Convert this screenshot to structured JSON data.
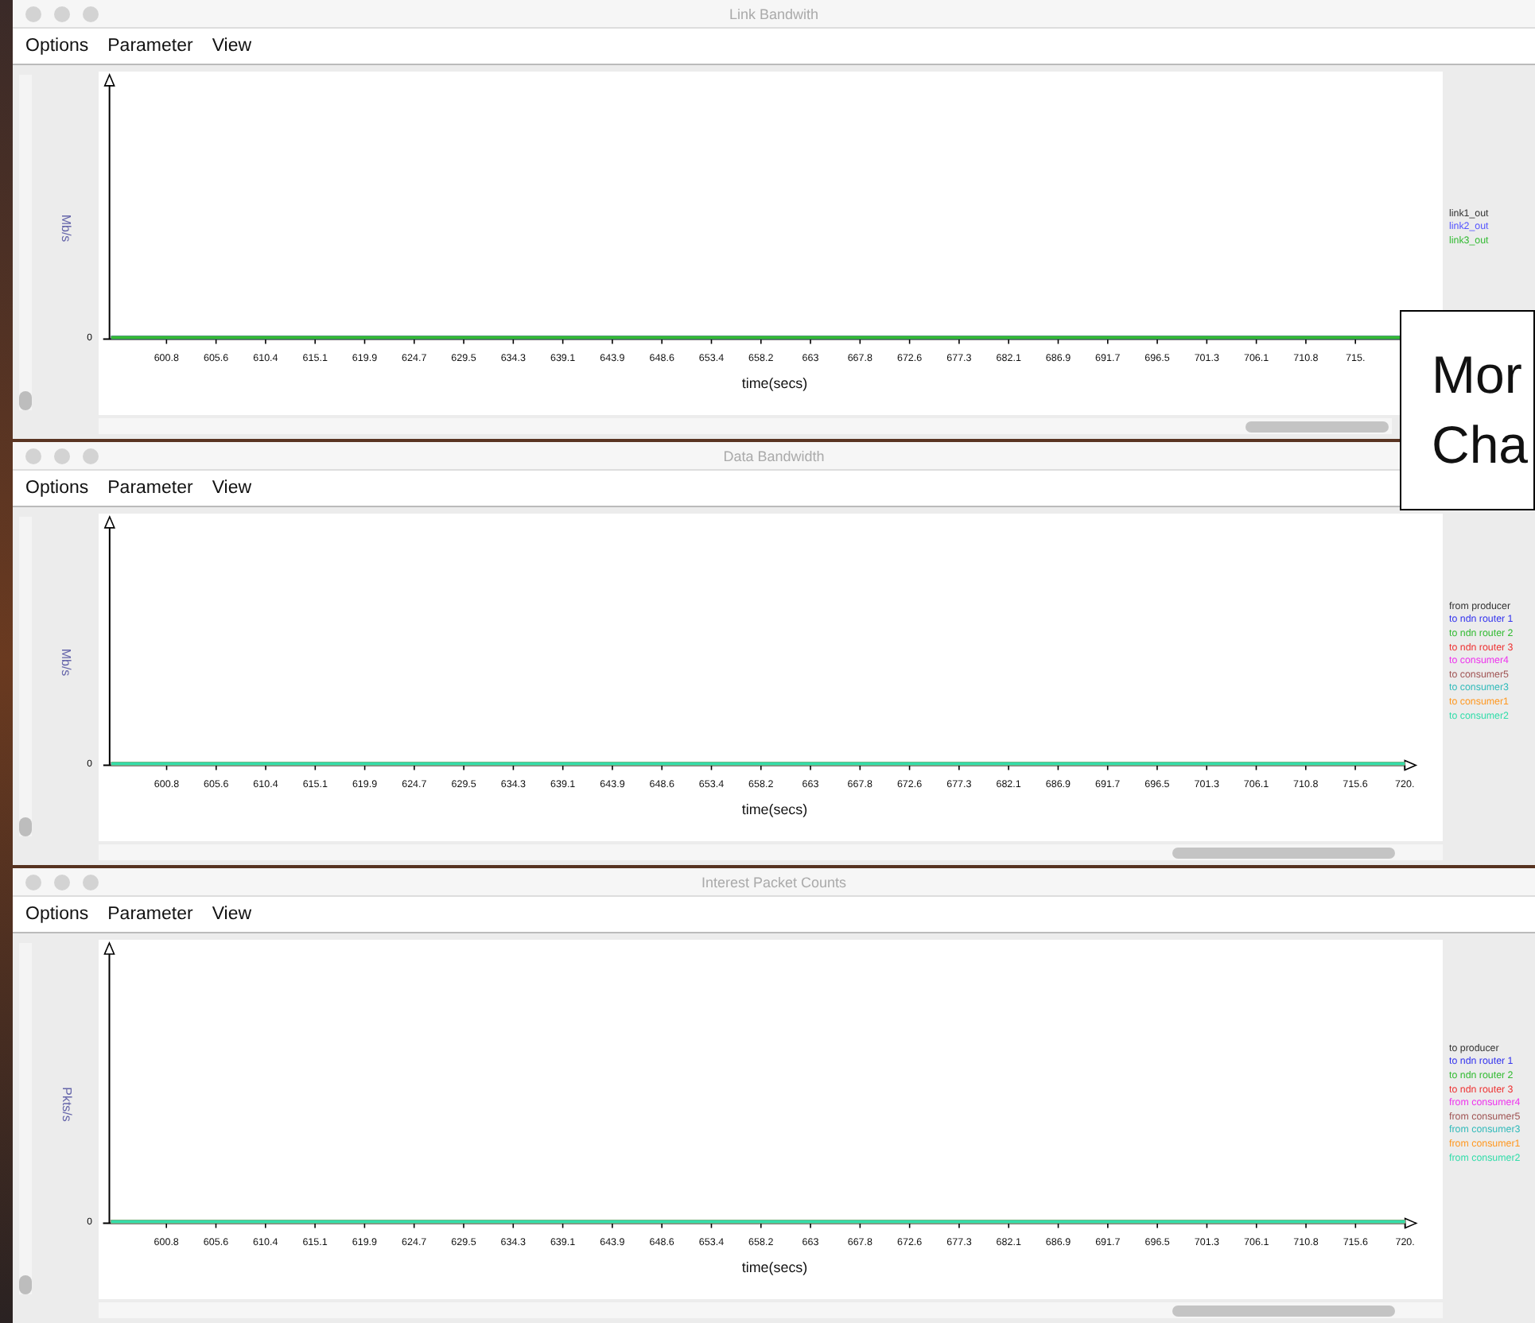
{
  "windows": [
    {
      "title": "Link Bandwith",
      "menus": [
        "Options",
        "Parameter",
        "View"
      ],
      "y_axis_title": "Mb/s",
      "y_tick_label": "0",
      "x_axis_title": "time(secs)",
      "x_tick_labels": [
        "600.8",
        "605.6",
        "610.4",
        "615.1",
        "619.9",
        "624.7",
        "629.5",
        "634.3",
        "639.1",
        "643.9",
        "648.6",
        "653.4",
        "658.2",
        "663",
        "667.8",
        "672.6",
        "677.3",
        "682.1",
        "686.9",
        "691.7",
        "696.5",
        "701.3",
        "706.1",
        "710.8",
        "715."
      ],
      "legend": [
        {
          "name": "link1_out",
          "color": "#333333"
        },
        {
          "name": "link2_out",
          "color": "#5555ff"
        },
        {
          "name": "link3_out",
          "color": "#33bb33"
        }
      ]
    },
    {
      "title": "Data Bandwidth",
      "menus": [
        "Options",
        "Parameter",
        "View"
      ],
      "y_axis_title": "Mb/s",
      "y_tick_label": "0",
      "x_axis_title": "time(secs)",
      "x_tick_labels": [
        "600.8",
        "605.6",
        "610.4",
        "615.1",
        "619.9",
        "624.7",
        "629.5",
        "634.3",
        "639.1",
        "643.9",
        "648.6",
        "653.4",
        "658.2",
        "663",
        "667.8",
        "672.6",
        "677.3",
        "682.1",
        "686.9",
        "691.7",
        "696.5",
        "701.3",
        "706.1",
        "710.8",
        "715.6",
        "720."
      ],
      "legend": [
        {
          "name": "from producer",
          "color": "#333333"
        },
        {
          "name": "to ndn router 1",
          "color": "#3333ee"
        },
        {
          "name": "to ndn router 2",
          "color": "#33bb33"
        },
        {
          "name": "to ndn router 3",
          "color": "#ee3333"
        },
        {
          "name": "to consumer4",
          "color": "#ee33ee"
        },
        {
          "name": "to consumer5",
          "color": "#a05555"
        },
        {
          "name": "to consumer3",
          "color": "#33bbbb"
        },
        {
          "name": "to consumer1",
          "color": "#ff9922"
        },
        {
          "name": "to consumer2",
          "color": "#33ddaa"
        }
      ]
    },
    {
      "title": "Interest Packet Counts",
      "menus": [
        "Options",
        "Parameter",
        "View"
      ],
      "y_axis_title": "Pkts/s",
      "y_tick_label": "0",
      "x_axis_title": "time(secs)",
      "x_tick_labels": [
        "600.8",
        "605.6",
        "610.4",
        "615.1",
        "619.9",
        "624.7",
        "629.5",
        "634.3",
        "639.1",
        "643.9",
        "648.6",
        "653.4",
        "658.2",
        "663",
        "667.8",
        "672.6",
        "677.3",
        "682.1",
        "686.9",
        "691.7",
        "696.5",
        "701.3",
        "706.1",
        "710.8",
        "715.6",
        "720."
      ],
      "legend": [
        {
          "name": "to producer",
          "color": "#333333"
        },
        {
          "name": "to ndn router 1",
          "color": "#3333ee"
        },
        {
          "name": "to ndn router 2",
          "color": "#33bb33"
        },
        {
          "name": "to ndn router 3",
          "color": "#ee3333"
        },
        {
          "name": "from consumer4",
          "color": "#ee33ee"
        },
        {
          "name": "from consumer5",
          "color": "#a05555"
        },
        {
          "name": "from consumer3",
          "color": "#33bbbb"
        },
        {
          "name": "from consumer1",
          "color": "#ff9922"
        },
        {
          "name": "from consumer2",
          "color": "#33ddaa"
        }
      ]
    }
  ],
  "callout": {
    "lines": [
      "Mor",
      "Cha"
    ]
  }
}
